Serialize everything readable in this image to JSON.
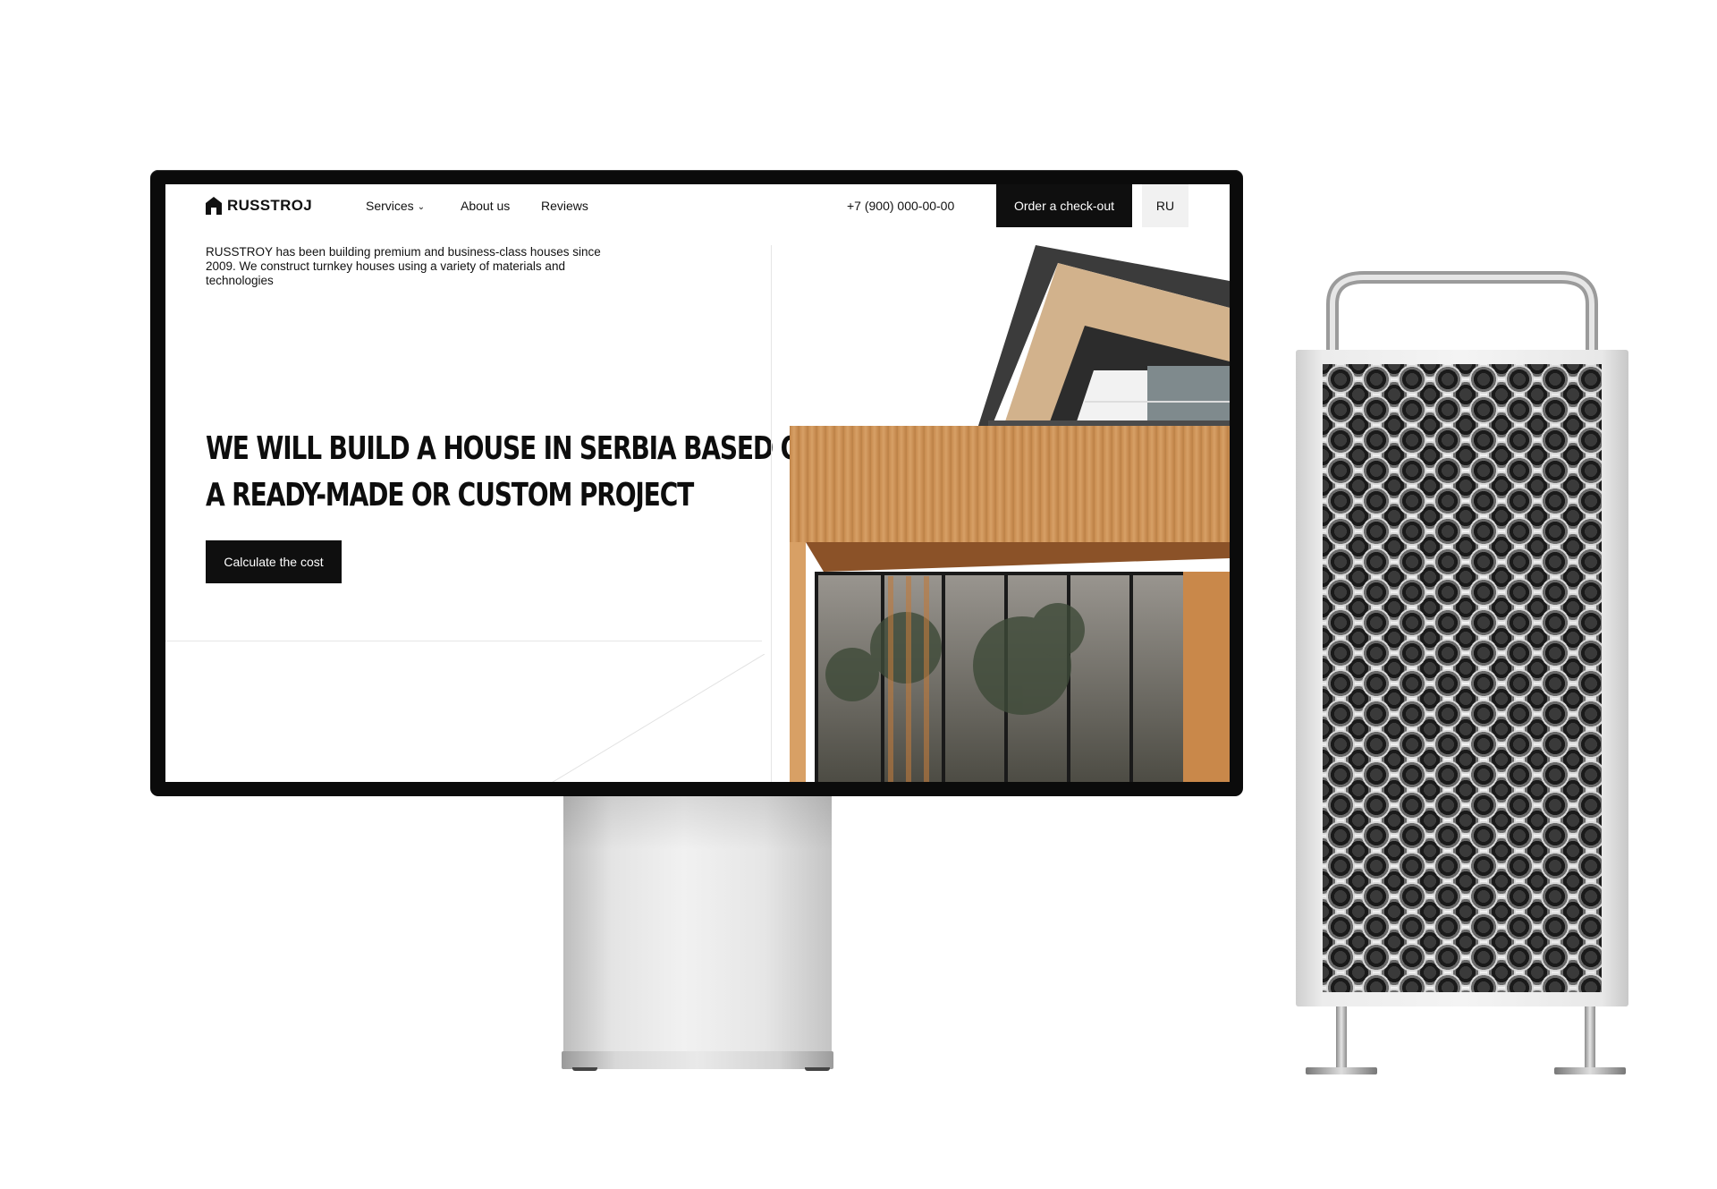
{
  "site": {
    "logo_text": "RUSSTROJ",
    "nav": {
      "services": "Services",
      "about": "About us",
      "reviews": "Reviews"
    },
    "phone": "+7 (900) 000-00-00",
    "order_button": "Order a check-out",
    "language": "RU",
    "intro": "RUSSTROY has been building premium and business-class houses since 2009. We construct turnkey houses using a variety of materials and technologies",
    "headline_line1": "We will build a house in Serbia based on",
    "headline_line2": "a ready-made or custom project",
    "cta_button": "Calculate the cost"
  },
  "colors": {
    "primary": "#0f0f0f",
    "background": "#ffffff",
    "lang_bg": "#f1f1f1",
    "wood": "#c98d4f"
  },
  "icons": {
    "logo": "house-logo-icon",
    "services_dropdown": "chevron-down-icon"
  }
}
